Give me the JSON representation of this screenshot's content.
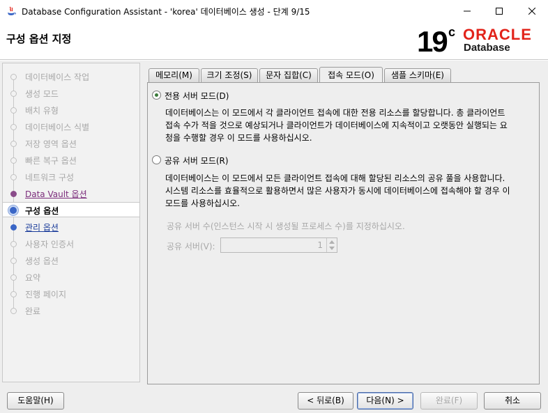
{
  "window": {
    "title": "Database Configuration Assistant - 'korea' 데이터베이스 생성 - 단계 9/15"
  },
  "header": {
    "page_title": "구성 옵션 지정",
    "logo_version": "19",
    "logo_superscript": "c",
    "logo_brand": "ORACLE",
    "logo_product": "Database",
    "brand_color": "#e2231a"
  },
  "sidebar": {
    "steps": [
      {
        "label": "데이터베이스 작업",
        "state": "disabled"
      },
      {
        "label": "생성 모드",
        "state": "disabled"
      },
      {
        "label": "배치 유형",
        "state": "disabled"
      },
      {
        "label": "데이터베이스 식별",
        "state": "disabled"
      },
      {
        "label": "저장 영역 옵션",
        "state": "disabled"
      },
      {
        "label": "빠른 복구 옵션",
        "state": "disabled"
      },
      {
        "label": "네트워크 구성",
        "state": "disabled"
      },
      {
        "label": "Data Vault 옵션",
        "state": "visited"
      },
      {
        "label": "구성 옵션",
        "state": "current"
      },
      {
        "label": "관리 옵션",
        "state": "link"
      },
      {
        "label": "사용자 인증서",
        "state": "disabled"
      },
      {
        "label": "생성 옵션",
        "state": "disabled"
      },
      {
        "label": "요약",
        "state": "disabled"
      },
      {
        "label": "진행 페이지",
        "state": "disabled"
      },
      {
        "label": "완료",
        "state": "disabled"
      }
    ]
  },
  "tabs": [
    {
      "label": "메모리(M)",
      "active": false
    },
    {
      "label": "크기 조정(S)",
      "active": false
    },
    {
      "label": "문자 집합(C)",
      "active": false
    },
    {
      "label": "접속 모드(O)",
      "active": true
    },
    {
      "label": "샘플 스키마(E)",
      "active": false
    }
  ],
  "connection_mode": {
    "dedicated": {
      "label": "전용 서버 모드(D)",
      "selected": true,
      "desc_lines": [
        "데이터베이스는 이 모드에서 각 클라이언트 접속에 대한 전용 리소스를 할당합니다. 총 클라이언트",
        "접속 수가 적을 것으로 예상되거나 클라이언트가 데이터베이스에 지속적이고 오랫동안 실행되는 요",
        "청을 수행할 경우 이 모드를 사용하십시오."
      ]
    },
    "shared": {
      "label": "공유 서버 모드(R)",
      "selected": false,
      "desc_lines": [
        "데이터베이스는 이 모드에서 모든 클라이언트 접속에 대해 할당된 리소스의 공유 풀을 사용합니다.",
        "시스템 리소스를 효율적으로 활용하면서 많은 사용자가 동시에 데이터베이스에 접속해야 할 경우 이",
        "모드를 사용하십시오."
      ],
      "hint": "공유 서버 수(인스턴스 시작 시 생성될 프로세스 수)를 지정하십시오.",
      "count_label": "공유 서버(V):",
      "count_value": "1"
    }
  },
  "footer": {
    "help": "도움말(H)",
    "back": "< 뒤로(B)",
    "next": "다음(N) >",
    "finish": "완료(F)",
    "cancel": "취소"
  }
}
